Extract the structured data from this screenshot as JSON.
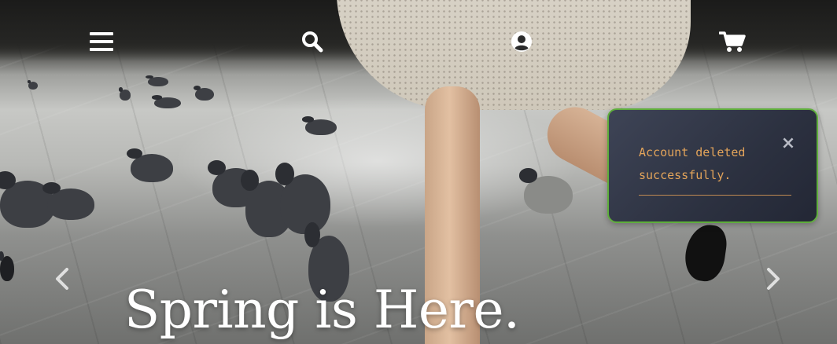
{
  "nav": {
    "menu_icon": "hamburger-menu-icon",
    "search_icon": "search-icon",
    "account_icon": "user-account-icon",
    "cart_icon": "shopping-cart-icon"
  },
  "carousel": {
    "prev_icon": "chevron-left-icon",
    "next_icon": "chevron-right-icon",
    "headline": "Spring is Here."
  },
  "toast": {
    "message": "Account deleted successfully.",
    "close_symbol": "×",
    "border_color": "#5fae3c",
    "text_color": "#e3a45a"
  }
}
